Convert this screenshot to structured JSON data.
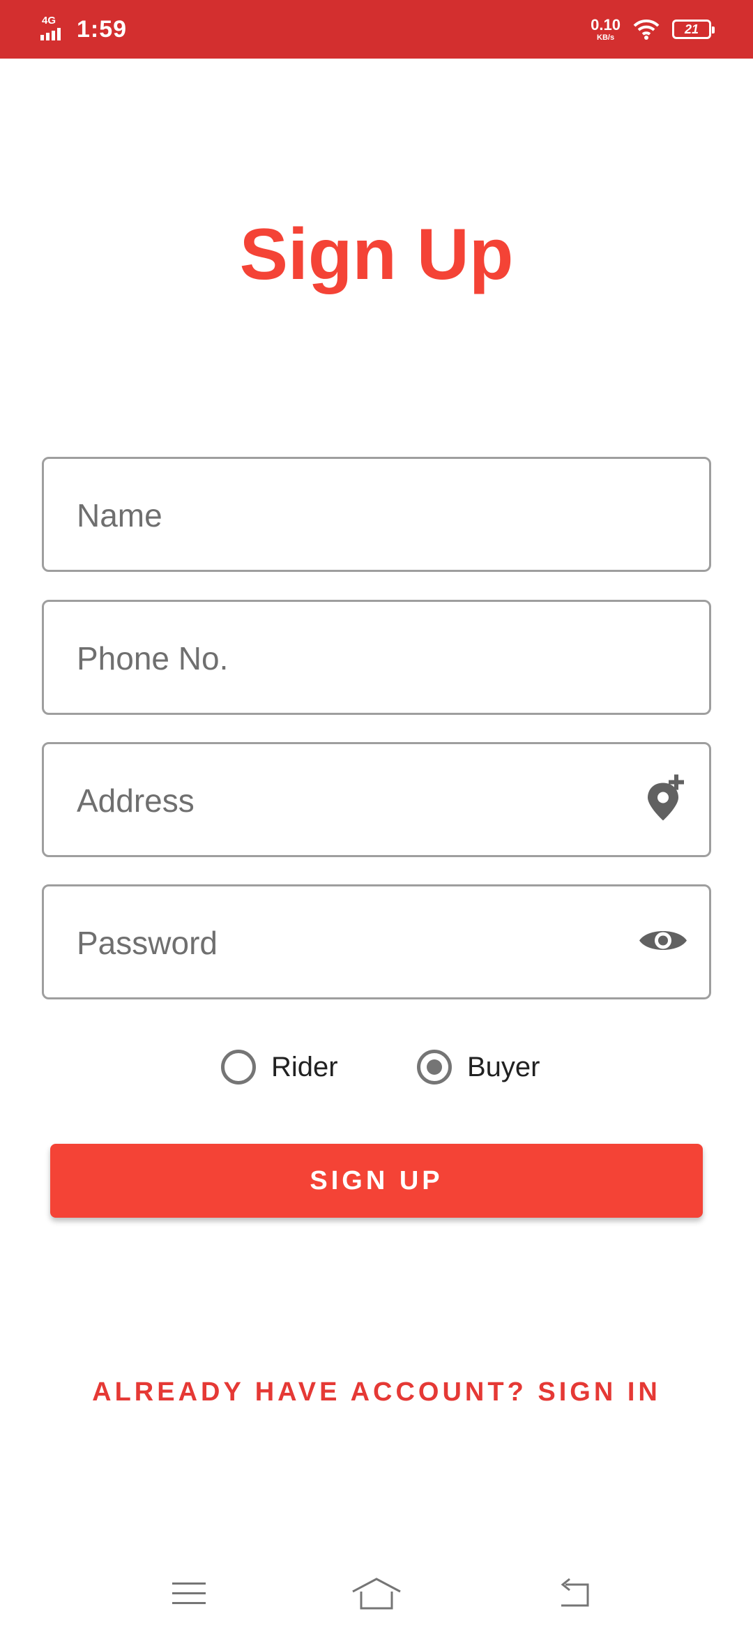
{
  "status_bar": {
    "network": "4G",
    "time": "1:59",
    "speed_value": "0.10",
    "speed_unit": "KB/s",
    "battery": "21"
  },
  "page": {
    "title": "Sign Up"
  },
  "form": {
    "name_placeholder": "Name",
    "phone_placeholder": "Phone No.",
    "address_placeholder": "Address",
    "password_placeholder": "Password",
    "address_icon": "add-location-icon",
    "password_icon": "eye-icon"
  },
  "role": {
    "options": [
      "Rider",
      "Buyer"
    ],
    "selected": "Buyer"
  },
  "actions": {
    "signup_label": "SIGN UP",
    "signin_link": "ALREADY HAVE ACCOUNT? SIGN IN"
  },
  "colors": {
    "status_bar": "#d32f2f",
    "accent": "#f44336",
    "border": "#9e9e9e"
  }
}
